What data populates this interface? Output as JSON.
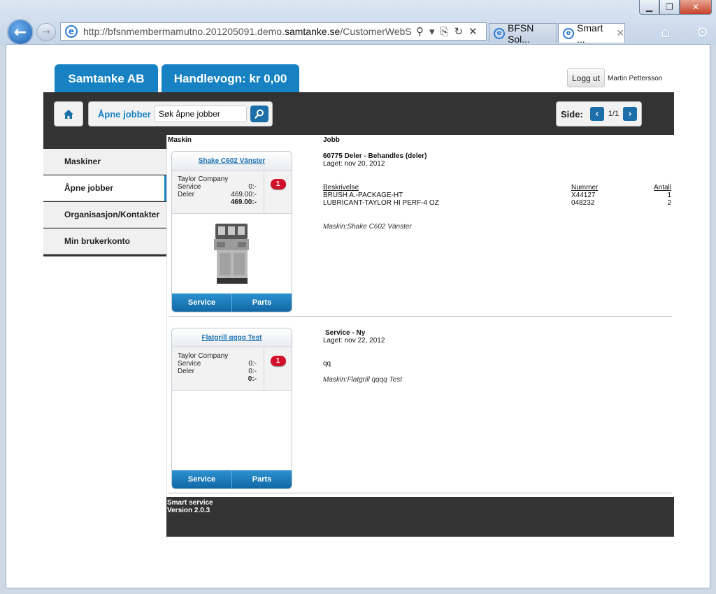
{
  "browser": {
    "url_prefix": "http://bfsnmembermamutno.201205091.demo.",
    "url_domain": "samtanke.se",
    "url_suffix": "/CustomerWebSite/V",
    "tabs": [
      {
        "label": "BFSN Sol..."
      },
      {
        "label": "Smart ..."
      }
    ]
  },
  "header": {
    "company_tab": "Samtanke AB",
    "cart_tab": "Handlevogn: kr 0,00",
    "logout": "Logg ut",
    "user": "Martin Pettersson"
  },
  "toolbar": {
    "search_label": "Åpne jobber",
    "search_value": "Søk åpne jobber",
    "page_label": "Side:",
    "page_value": "1/1"
  },
  "sidebar": {
    "items": [
      {
        "label": "Maskiner"
      },
      {
        "label": "Åpne jobber"
      },
      {
        "label": "Organisasjon/Kontakter"
      },
      {
        "label": "Min brukerkonto"
      }
    ]
  },
  "columns": {
    "machine": "Maskin",
    "job": "Jobb"
  },
  "entries": [
    {
      "machine": {
        "name": "Shake C602 Vänster",
        "company": "Taylor Company",
        "service_label": "Service",
        "service_value": "0:-",
        "parts_label": "Deler",
        "parts_value": "469.00:-",
        "total": "469.00:-",
        "badge": "1",
        "btn_service": "Service",
        "btn_parts": "Parts"
      },
      "job": {
        "title": "60775 Deler - Behandles (deler)",
        "created": "Laget: nov 20, 2012",
        "parts_headers": {
          "desc": "Beskrivelse",
          "num": "Nummer",
          "qty": "Antall"
        },
        "parts": [
          {
            "desc": "BRUSH A.-PACKAGE-HT",
            "num": "X44127",
            "qty": "1"
          },
          {
            "desc": "LUBRICANT-TAYLOR HI PERF-4 OZ",
            "num": "048232",
            "qty": "2"
          }
        ],
        "machine_note": "Maskin:Shake C602 Vänster"
      }
    },
    {
      "machine": {
        "name": "Flatgrill qqqq Test",
        "company": "Taylor Company",
        "service_label": "Service",
        "service_value": "0:-",
        "parts_label": "Deler",
        "parts_value": "0:-",
        "total": "0:-",
        "badge": "1",
        "btn_service": "Service",
        "btn_parts": "Parts"
      },
      "job": {
        "title": "Service - Ny",
        "created": "Laget: nov 22, 2012",
        "description": "qq",
        "machine_note": "Maskin:Flatgrill qqqq Test"
      }
    }
  ],
  "footer": {
    "line1": "Smart service",
    "line2": "Version 2.0.3"
  },
  "colors": {
    "accent": "#1682c4",
    "dark": "#333333",
    "badge": "#d2102a"
  }
}
